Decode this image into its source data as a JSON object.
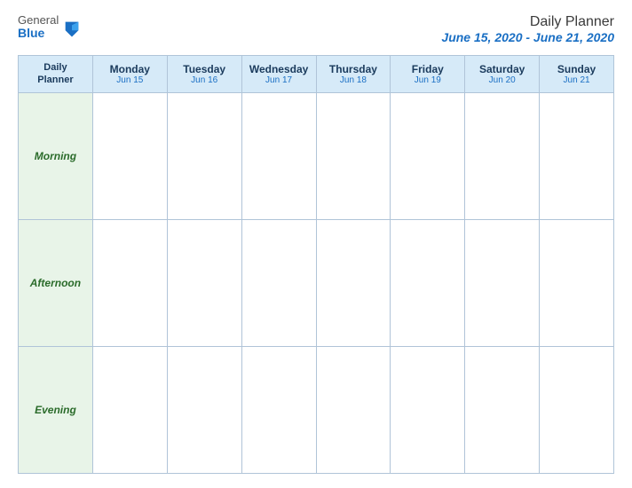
{
  "header": {
    "logo": {
      "general": "General",
      "blue": "Blue"
    },
    "title": "Daily Planner",
    "date_range": "June 15, 2020 - June 21, 2020"
  },
  "table": {
    "label_column": {
      "header_line1": "Daily",
      "header_line2": "Planner",
      "row_labels": [
        "Morning",
        "Afternoon",
        "Evening"
      ]
    },
    "days": [
      {
        "name": "Monday",
        "date": "Jun 15"
      },
      {
        "name": "Tuesday",
        "date": "Jun 16"
      },
      {
        "name": "Wednesday",
        "date": "Jun 17"
      },
      {
        "name": "Thursday",
        "date": "Jun 18"
      },
      {
        "name": "Friday",
        "date": "Jun 19"
      },
      {
        "name": "Saturday",
        "date": "Jun 20"
      },
      {
        "name": "Sunday",
        "date": "Jun 21"
      }
    ]
  },
  "colors": {
    "header_bg": "#d6eaf8",
    "label_bg": "#e8f4e8",
    "border": "#b0c4d8",
    "accent_blue": "#1a6fc4",
    "text_dark": "#1a3a5c",
    "label_green": "#2a6b2a"
  }
}
